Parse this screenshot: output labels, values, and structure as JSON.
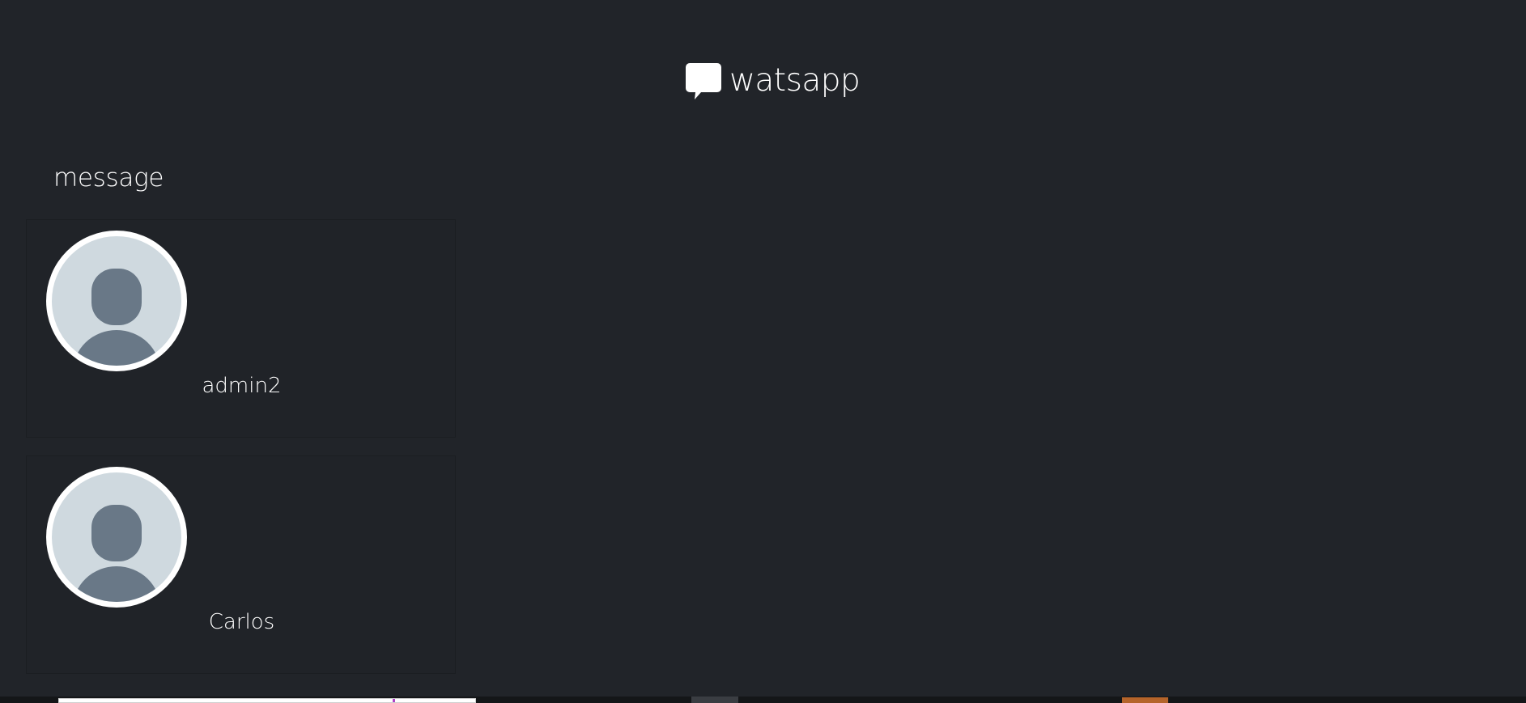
{
  "header": {
    "app_name": "watsapp",
    "icon": "chat-bubble-icon"
  },
  "section": {
    "title": "message"
  },
  "contacts": [
    {
      "name": "admin2",
      "avatar_icon": "default-user-avatar-icon"
    },
    {
      "name": "Carlos",
      "avatar_icon": "default-user-avatar-icon"
    }
  ],
  "colors": {
    "background": "#212429",
    "card_background": "#202328",
    "avatar_background": "#cfd9df",
    "avatar_silhouette": "#697887",
    "text": "#ffffff",
    "accent_orange": "#b5642a"
  }
}
